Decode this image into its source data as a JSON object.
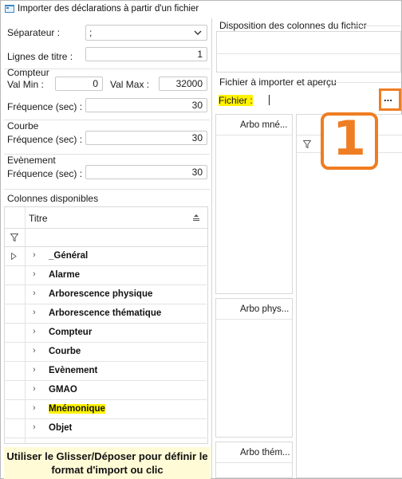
{
  "window": {
    "title": "Importer des déclarations à partir d'un fichier"
  },
  "left": {
    "separator": {
      "label": "Séparateur :",
      "value": ";"
    },
    "title_lines": {
      "label": "Lignes de titre :",
      "value": "1"
    },
    "counter": {
      "group": "Compteur",
      "min_label": "Val Min :",
      "min_value": "0",
      "max_label": "Val Max :",
      "max_value": "32000",
      "freq_label": "Fréquence (sec) :",
      "freq_value": "30"
    },
    "curve": {
      "group": "Courbe",
      "freq_label": "Fréquence (sec) :",
      "freq_value": "30"
    },
    "event": {
      "group": "Evènement",
      "freq_label": "Fréquence (sec) :",
      "freq_value": "30"
    },
    "available_columns": {
      "group": "Colonnes disponibles",
      "header": "Titre",
      "items": [
        "_Général",
        "Alarme",
        "Arborescence physique",
        "Arborescence thématique",
        "Compteur",
        "Courbe",
        "Evènement",
        "GMAO",
        "Mnémonique",
        "Objet"
      ]
    },
    "hint": "Utiliser le Glisser/Déposer pour définir le format d'import ou clic"
  },
  "right": {
    "layout_group": "Disposition des colonnes du fichier",
    "file_group": "Fichier à importer et aperçu",
    "file_label": "Fichier :",
    "file_value": "",
    "browse_label": "...",
    "callout": "1",
    "columns": {
      "arbo_mnemo": "Arbo mné...",
      "arbo_phys": "Arbo phys...",
      "arbo_them": "Arbo thém..."
    }
  },
  "colors": {
    "accent": "#ef7d22",
    "highlight": "#fff200",
    "hint_bg": "#fffbd6"
  }
}
